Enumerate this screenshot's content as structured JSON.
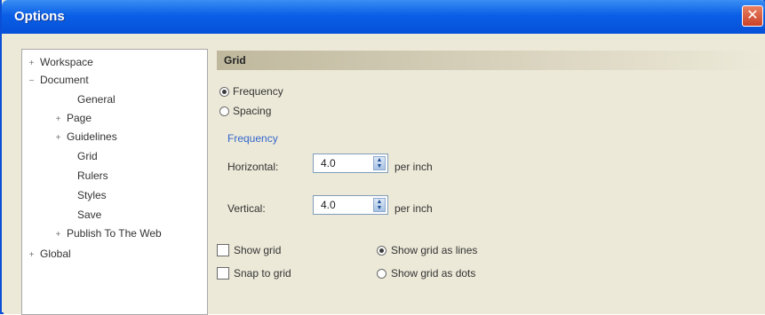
{
  "window": {
    "title": "Options",
    "close_label": "✕"
  },
  "tree": {
    "items": [
      {
        "label": "Workspace",
        "expander": "+"
      },
      {
        "label": "Document",
        "expander": "−"
      },
      {
        "label": "General",
        "expander": ""
      },
      {
        "label": "Page",
        "expander": "+"
      },
      {
        "label": "Guidelines",
        "expander": "+"
      },
      {
        "label": "Grid",
        "expander": ""
      },
      {
        "label": "Rulers",
        "expander": ""
      },
      {
        "label": "Styles",
        "expander": ""
      },
      {
        "label": "Save",
        "expander": ""
      },
      {
        "label": "Publish To The Web",
        "expander": "+"
      },
      {
        "label": "Global",
        "expander": "+"
      }
    ]
  },
  "panel": {
    "title": "Grid",
    "radio_frequency": "Frequency",
    "radio_spacing": "Spacing",
    "group_label": "Frequency",
    "horizontal_label": "Horizontal:",
    "horizontal_value": "4.0",
    "vertical_label": "Vertical:",
    "vertical_value": "4.0",
    "unit": "per inch",
    "show_grid": "Show grid",
    "snap_to_grid": "Snap to grid",
    "show_as_lines": "Show grid as lines",
    "show_as_dots": "Show grid as dots"
  }
}
